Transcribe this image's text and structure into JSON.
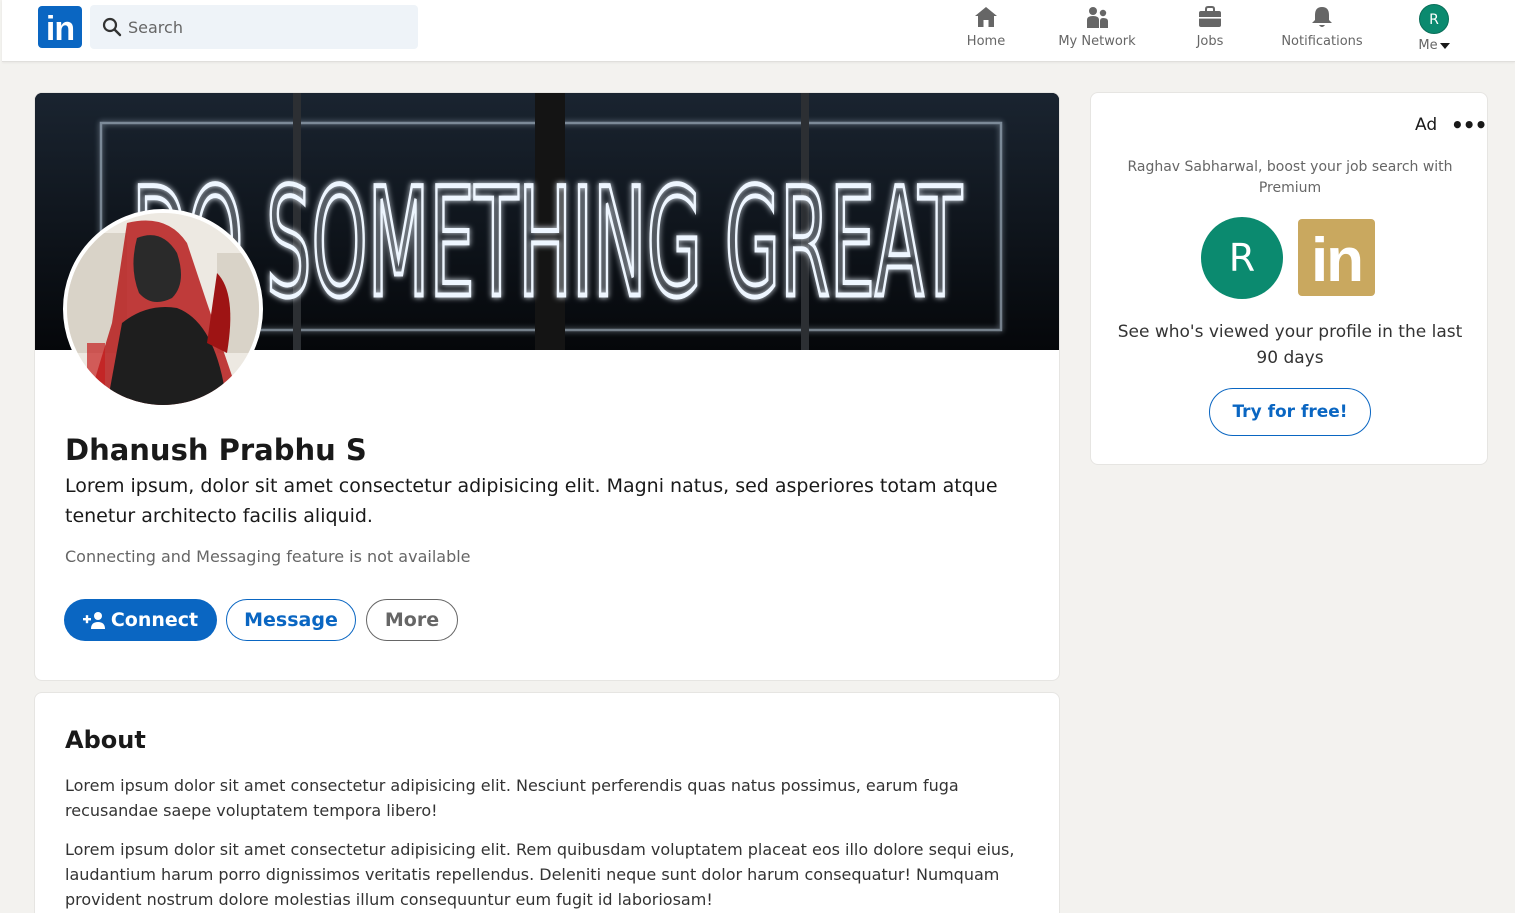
{
  "nav": {
    "logo_text": "in",
    "search_placeholder": "Search",
    "items": [
      {
        "label": "Home",
        "icon": "home-icon"
      },
      {
        "label": "My Network",
        "icon": "network-icon"
      },
      {
        "label": "Jobs",
        "icon": "briefcase-icon"
      },
      {
        "label": "Notifications",
        "icon": "bell-icon"
      },
      {
        "label": "Me",
        "icon": "user-avatar"
      }
    ],
    "me_initial": "R"
  },
  "profile": {
    "banner_text": "DO SOMETHING GREAT",
    "name": "Dhanush Prabhu S",
    "headline": "Lorem ipsum, dolor sit amet consectetur adipisicing elit. Magni natus, sed asperiores totam atque tenetur architecto facilis aliquid.",
    "notice": "Connecting and Messaging feature is not available",
    "buttons": {
      "connect": "Connect",
      "message": "Message",
      "more": "More"
    }
  },
  "about": {
    "title": "About",
    "paragraphs": [
      "Lorem ipsum dolor sit amet consectetur adipisicing elit. Nesciunt perferendis quas natus possimus, earum fuga recusandae saepe voluptatem tempora libero!",
      "Lorem ipsum dolor sit amet consectetur adipisicing elit. Rem quibusdam voluptatem placeat eos illo dolore sequi eius, laudantium harum porro dignissimos veritatis repellendus. Deleniti neque sunt dolor harum consequatur! Numquam provident nostrum dolore molestias illum consequuntur eum fugit id laboriosam!"
    ]
  },
  "ad": {
    "label": "Ad",
    "menu": "•••",
    "offer": "Raghav Sabharwal, boost your job search with Premium",
    "user_initial": "R",
    "brand_text": "in",
    "copy": "See who's viewed your profile in the last 90 days",
    "cta": "Try for free!"
  },
  "colors": {
    "brand_blue": "#0a66c2",
    "avatar_green": "#0b8a6f",
    "premium_gold": "#c9a85f",
    "page_bg": "#f3f2ef"
  }
}
